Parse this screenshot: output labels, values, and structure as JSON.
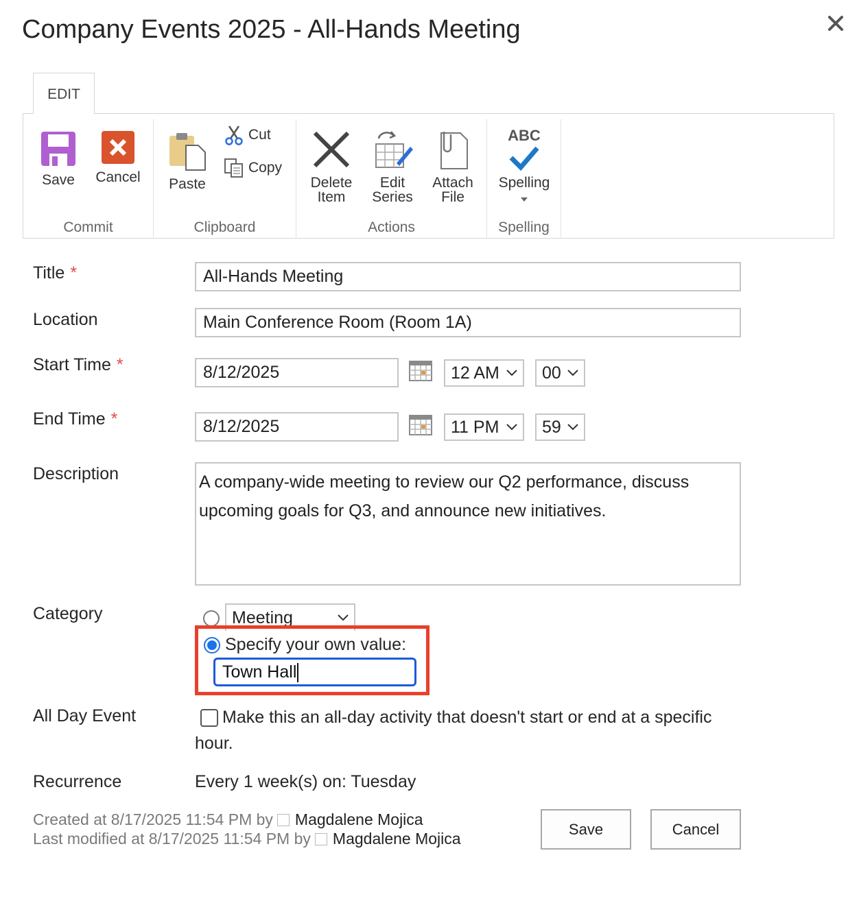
{
  "dialog": {
    "title": "Company Events 2025 - All-Hands Meeting"
  },
  "ribbon": {
    "tab": "EDIT",
    "groups": {
      "commit": {
        "label": "Commit",
        "save": "Save",
        "cancel": "Cancel"
      },
      "clipboard": {
        "label": "Clipboard",
        "paste": "Paste",
        "cut": "Cut",
        "copy": "Copy"
      },
      "actions": {
        "label": "Actions",
        "delete_1": "Delete",
        "delete_2": "Item",
        "edit_1": "Edit",
        "edit_2": "Series",
        "attach_1": "Attach",
        "attach_2": "File"
      },
      "spelling": {
        "label": "Spelling",
        "spelling": "Spelling",
        "abc": "ABC"
      }
    }
  },
  "form": {
    "title": {
      "label": "Title",
      "required": "*",
      "value": "All-Hands Meeting"
    },
    "location": {
      "label": "Location",
      "value": "Main Conference Room (Room 1A)"
    },
    "start_time": {
      "label": "Start Time",
      "required": "*",
      "date": "8/12/2025",
      "hour": "12 AM",
      "minute": "00"
    },
    "end_time": {
      "label": "End Time",
      "required": "*",
      "date": "8/12/2025",
      "hour": "11 PM",
      "minute": "59"
    },
    "description": {
      "label": "Description",
      "value": "A company-wide meeting to review our Q2 performance, discuss upcoming goals for Q3, and announce new initiatives."
    },
    "category": {
      "label": "Category",
      "dropdown_value": "Meeting",
      "own_value_label": "Specify your own value:",
      "own_value": "Town Hall",
      "selected": "own"
    },
    "all_day": {
      "label": "All Day Event",
      "checkbox_text": "Make this an all-day activity that doesn't start or end at a specific",
      "checkbox_text_2": "hour.",
      "checked": false
    },
    "recurrence": {
      "label": "Recurrence",
      "value": "Every 1 week(s) on: Tuesday"
    }
  },
  "footer": {
    "created_prefix": "Created at 8/17/2025 11:54 PM by",
    "created_user": "Magdalene Mojica",
    "modified_prefix": "Last modified at 8/17/2025 11:54 PM by",
    "modified_user": "Magdalene Mojica",
    "save": "Save",
    "cancel": "Cancel"
  },
  "colors": {
    "accent": "#1a73e8",
    "highlight": "#e8402a",
    "save_icon": "#b05fd0",
    "cancel_icon": "#d9532c",
    "check_icon": "#1e78c8"
  }
}
